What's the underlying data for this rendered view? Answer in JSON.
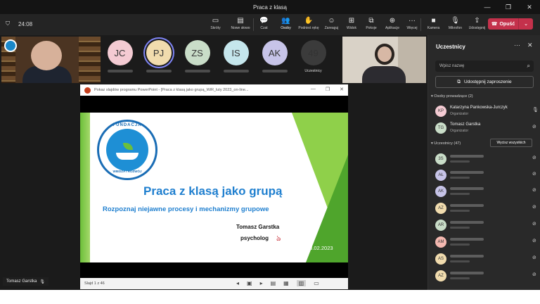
{
  "window": {
    "title": "Praca z klasą",
    "minimize": "—",
    "maximize": "❐",
    "close": "✕"
  },
  "toolbar": {
    "timer": "24:08",
    "buttons": [
      {
        "icon": "chat-icon",
        "label": "Czat"
      },
      {
        "icon": "people-icon",
        "label": "Osoby"
      },
      {
        "icon": "raise-hand-icon",
        "label": "Podnieś rękę"
      },
      {
        "icon": "reactions-icon",
        "label": "Zareaguj"
      },
      {
        "icon": "view-icon",
        "label": "Widok"
      },
      {
        "icon": "rooms-icon",
        "label": "Pokoje"
      },
      {
        "icon": "apps-icon",
        "label": "Aplikacje"
      },
      {
        "icon": "more-icon",
        "label": "Więcej"
      }
    ],
    "left_buttons": [
      {
        "icon": "record-icon",
        "label": "Skróty"
      },
      {
        "icon": "notes-icon",
        "label": "Nowe słowo"
      }
    ],
    "media": [
      {
        "icon": "camera-icon",
        "label": "Kamera"
      },
      {
        "icon": "mic-icon",
        "label": "Mikrofon"
      },
      {
        "icon": "share-icon",
        "label": "Udostępnij"
      }
    ],
    "leave_label": "Opuść"
  },
  "avatars": [
    {
      "initials": "JC",
      "color": "#f4cbd3"
    },
    {
      "initials": "PJ",
      "color": "#f1dcae",
      "selected": true
    },
    {
      "initials": "ZS",
      "color": "#c9ddc8"
    },
    {
      "initials": "IS",
      "color": "#c5e6ec"
    },
    {
      "initials": "AK",
      "color": "#c7c4e8"
    }
  ],
  "participants_tile": {
    "count": "49",
    "label": "Uczestnicy"
  },
  "ppt": {
    "window_title": "Pokaz slajdów programu PowerPoint - [Praca z klasą jako grupą_WiR_luty 2023_on-line...",
    "status": "Slajd 1 z 46",
    "slide": {
      "logo_top": "FUNDACJA",
      "logo_bottom": "WIEDZA I ROZWÓJ",
      "title": "Praca z klasą jako grupą",
      "subtitle": "Rozpoznaj niejawne procesy i mechanizmy grupowe",
      "author": "Tomasz Garstka",
      "role": "psycholog",
      "date": "13.02.2023"
    }
  },
  "name_tag": "Tomasz Garstka",
  "panel": {
    "title": "Uczestnicy",
    "search_placeholder": "Wpisz nazwę",
    "invite_label": "Udostępnij zaproszenie",
    "organizers_header": "Osoby prowadzące (2)",
    "attendees_header": "Uczestnicy (47)",
    "mute_all_label": "Wycisz wszystkich",
    "organizers": [
      {
        "initials": "KP",
        "color": "#f4cbd3",
        "name": "Katarzyna Pankowska-Jurczyk",
        "role": "Organizator"
      },
      {
        "initials": "TG",
        "color": "#c9ddc8",
        "name": "Tomasz Garstka",
        "role": "Organizator"
      }
    ],
    "attendees": [
      {
        "initials": "3S",
        "color": "#c9ddc8"
      },
      {
        "initials": "AŁ",
        "color": "#c7c4e8"
      },
      {
        "initials": "AK",
        "color": "#c7c4e8"
      },
      {
        "initials": "AZ",
        "color": "#f1dcae"
      },
      {
        "initials": "AR",
        "color": "#c9ddc8"
      },
      {
        "initials": "AM",
        "color": "#f4b8b0"
      },
      {
        "initials": "AS",
        "color": "#f1dcae"
      },
      {
        "initials": "AZ",
        "color": "#f1dcae"
      }
    ]
  }
}
